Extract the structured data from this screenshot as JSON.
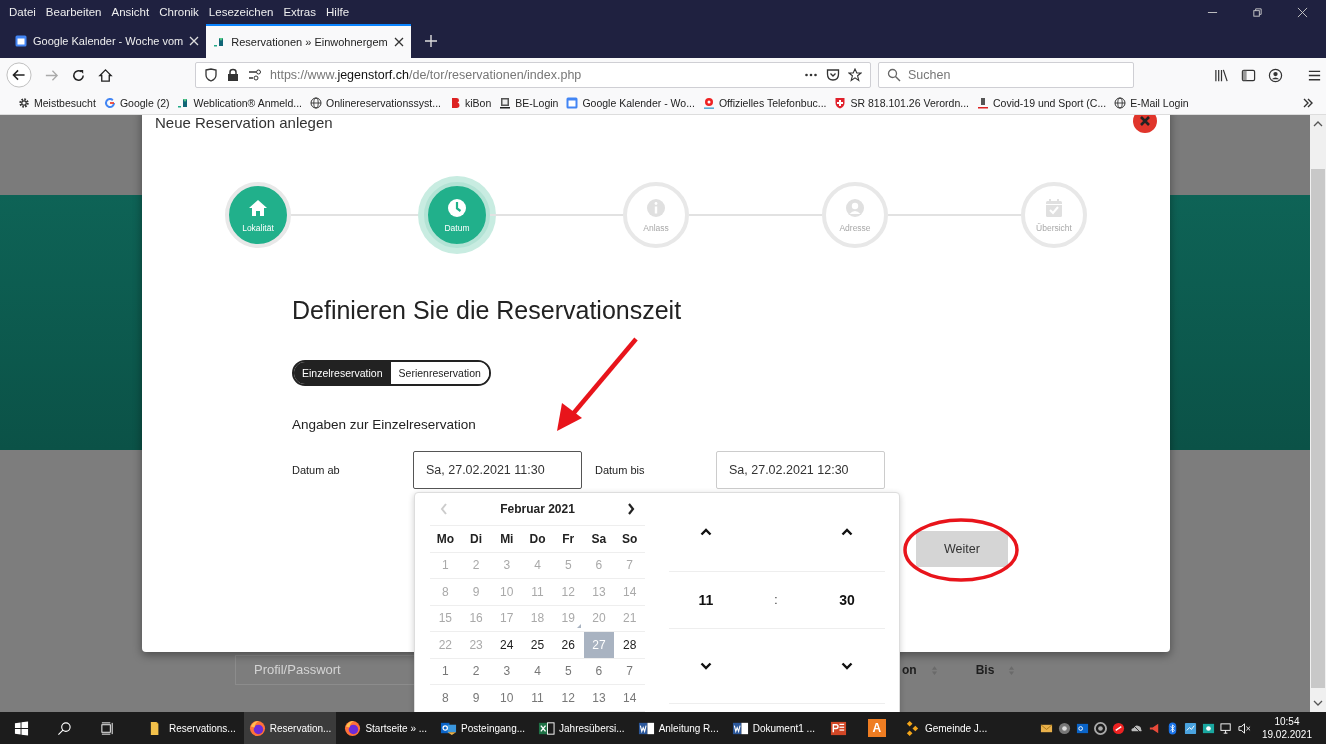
{
  "menu": [
    "Datei",
    "Bearbeiten",
    "Ansicht",
    "Chronik",
    "Lesezeichen",
    "Extras",
    "Hilfe"
  ],
  "tabs": [
    {
      "title": "Google Kalender - Woche vom",
      "selected": false
    },
    {
      "title": "Reservationen » Einwohnergem",
      "selected": true
    }
  ],
  "address": {
    "scheme": "https://www.",
    "domain": "jegenstorf.ch",
    "path": "/de/tor/reservationen/index.php"
  },
  "search": {
    "placeholder": "Suchen"
  },
  "bookmarks": [
    "Meistbesucht",
    "Google (2)",
    "Weblication® Anmeld...",
    "Onlinereservationssyst...",
    "kiBon",
    "BE-Login",
    "Google Kalender - Wo...",
    "Offizielles Telefonbuc...",
    "SR 818.101.26 Verordn...",
    "Covid-19 und Sport (C...",
    "E-Mail Login"
  ],
  "modal": {
    "title": "Neue Reservation anlegen",
    "steps": [
      {
        "label": "Lokalität",
        "done": true,
        "active": false
      },
      {
        "label": "Datum",
        "done": false,
        "active": true
      },
      {
        "label": "Anlass",
        "done": false,
        "active": false
      },
      {
        "label": "Adresse",
        "done": false,
        "active": false
      },
      {
        "label": "Übersicht",
        "done": false,
        "active": false
      }
    ],
    "heading": "Definieren Sie die Reservationszeit",
    "modes": [
      {
        "label": "Einzelreservation",
        "selected": true
      },
      {
        "label": "Serienreservation",
        "selected": false
      }
    ],
    "section_title": "Angaben zur Einzelreservation",
    "fields": [
      {
        "label": "Datum ab",
        "value": "Sa, 27.02.2021 11:30",
        "focused": true
      },
      {
        "label": "Datum bis",
        "value": "Sa, 27.02.2021 12:30",
        "focused": false
      }
    ],
    "next_button": "Weiter"
  },
  "datepicker": {
    "month": "Februar 2021",
    "prev_disabled": true,
    "weekdays": [
      "Mo",
      "Di",
      "Mi",
      "Do",
      "Fr",
      "Sa",
      "So"
    ],
    "weeks": [
      [
        {
          "day": "1",
          "kind": "disabled",
          "selected": false,
          "today": false
        },
        {
          "day": "2",
          "kind": "disabled",
          "selected": false,
          "today": false
        },
        {
          "day": "3",
          "kind": "disabled",
          "selected": false,
          "today": false
        },
        {
          "day": "4",
          "kind": "disabled",
          "selected": false,
          "today": false
        },
        {
          "day": "5",
          "kind": "disabled",
          "selected": false,
          "today": false
        },
        {
          "day": "6",
          "kind": "disabled",
          "selected": false,
          "today": false
        },
        {
          "day": "7",
          "kind": "disabled",
          "selected": false,
          "today": false
        }
      ],
      [
        {
          "day": "8",
          "kind": "disabled",
          "selected": false,
          "today": false
        },
        {
          "day": "9",
          "kind": "disabled",
          "selected": false,
          "today": false
        },
        {
          "day": "10",
          "kind": "disabled",
          "selected": false,
          "today": false
        },
        {
          "day": "11",
          "kind": "disabled",
          "selected": false,
          "today": false
        },
        {
          "day": "12",
          "kind": "disabled",
          "selected": false,
          "today": false
        },
        {
          "day": "13",
          "kind": "disabled",
          "selected": false,
          "today": false
        },
        {
          "day": "14",
          "kind": "disabled",
          "selected": false,
          "today": false
        }
      ],
      [
        {
          "day": "15",
          "kind": "disabled",
          "selected": false,
          "today": false
        },
        {
          "day": "16",
          "kind": "disabled",
          "selected": false,
          "today": false
        },
        {
          "day": "17",
          "kind": "disabled",
          "selected": false,
          "today": false
        },
        {
          "day": "18",
          "kind": "disabled",
          "selected": false,
          "today": false
        },
        {
          "day": "19",
          "kind": "disabled",
          "selected": false,
          "today": true
        },
        {
          "day": "20",
          "kind": "disabled",
          "selected": false,
          "today": false
        },
        {
          "day": "21",
          "kind": "disabled",
          "selected": false,
          "today": false
        }
      ],
      [
        {
          "day": "22",
          "kind": "disabled",
          "selected": false,
          "today": false
        },
        {
          "day": "23",
          "kind": "disabled",
          "selected": false,
          "today": false
        },
        {
          "day": "24",
          "kind": "current",
          "selected": false,
          "today": false
        },
        {
          "day": "25",
          "kind": "current",
          "selected": false,
          "today": false
        },
        {
          "day": "26",
          "kind": "current",
          "selected": false,
          "today": false
        },
        {
          "day": "27",
          "kind": "current",
          "selected": true,
          "today": false
        },
        {
          "day": "28",
          "kind": "current",
          "selected": false,
          "today": false
        }
      ],
      [
        {
          "day": "1",
          "kind": "other",
          "selected": false,
          "today": false
        },
        {
          "day": "2",
          "kind": "other",
          "selected": false,
          "today": false
        },
        {
          "day": "3",
          "kind": "other",
          "selected": false,
          "today": false
        },
        {
          "day": "4",
          "kind": "other",
          "selected": false,
          "today": false
        },
        {
          "day": "5",
          "kind": "other",
          "selected": false,
          "today": false
        },
        {
          "day": "6",
          "kind": "other",
          "selected": false,
          "today": false
        },
        {
          "day": "7",
          "kind": "other",
          "selected": false,
          "today": false
        }
      ],
      [
        {
          "day": "8",
          "kind": "other",
          "selected": false,
          "today": false
        },
        {
          "day": "9",
          "kind": "other",
          "selected": false,
          "today": false
        },
        {
          "day": "10",
          "kind": "other",
          "selected": false,
          "today": false
        },
        {
          "day": "11",
          "kind": "other",
          "selected": false,
          "today": false
        },
        {
          "day": "12",
          "kind": "other",
          "selected": false,
          "today": false
        },
        {
          "day": "13",
          "kind": "other",
          "selected": false,
          "today": false
        },
        {
          "day": "14",
          "kind": "other",
          "selected": false,
          "today": false
        }
      ]
    ],
    "hour": "11",
    "separator": ":",
    "minute": "30"
  },
  "background": {
    "profile_field": "Profil/Passwort",
    "columns": [
      "on",
      "Bis"
    ]
  },
  "taskbar": {
    "items": [
      {
        "label": "Reservations...",
        "selected": false
      },
      {
        "label": "Reservation...",
        "selected": true
      },
      {
        "label": "Startseite » ...",
        "selected": false
      },
      {
        "label": "Posteingang...",
        "selected": false
      },
      {
        "label": "Jahresübersi...",
        "selected": false
      },
      {
        "label": "Anleitung R...",
        "selected": false
      },
      {
        "label": "Dokument1 ...",
        "selected": false
      },
      {
        "selected": false
      },
      {
        "glyph": "A",
        "selected": false
      },
      {
        "label": "Gemeinde J...",
        "selected": false
      }
    ],
    "time": "10:54",
    "date": "19.02.2021"
  }
}
